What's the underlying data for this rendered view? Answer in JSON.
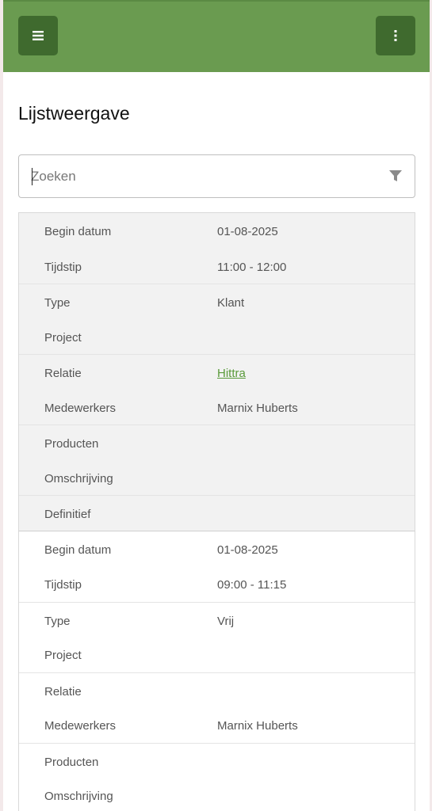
{
  "header": {
    "menu_icon": "hamburger-icon",
    "more_icon": "vertical-dots-icon",
    "bar_color": "#6a9b50",
    "button_color": "#3f6a2e"
  },
  "page_title": "Lijstweergave",
  "search": {
    "placeholder": "Zoeken",
    "value": "",
    "filter_icon": "filter-icon"
  },
  "records": [
    {
      "rows": [
        {
          "label": "Begin datum",
          "value": "01-08-2025"
        },
        {
          "label": "Tijdstip",
          "value": "11:00 - 12:00"
        },
        {
          "label": "Type",
          "value": "Klant"
        },
        {
          "label": "Project",
          "value": ""
        },
        {
          "label": "Relatie",
          "value": "Hittra",
          "link": true
        },
        {
          "label": "Medewerkers",
          "value": "Marnix Huberts"
        },
        {
          "label": "Producten",
          "value": ""
        },
        {
          "label": "Omschrijving",
          "value": ""
        },
        {
          "label": "Definitief",
          "value": ""
        }
      ]
    },
    {
      "rows": [
        {
          "label": "Begin datum",
          "value": "01-08-2025"
        },
        {
          "label": "Tijdstip",
          "value": "09:00 - 11:15"
        },
        {
          "label": "Type",
          "value": "Vrij"
        },
        {
          "label": "Project",
          "value": ""
        },
        {
          "label": "Relatie",
          "value": ""
        },
        {
          "label": "Medewerkers",
          "value": "Marnix Huberts"
        },
        {
          "label": "Producten",
          "value": ""
        },
        {
          "label": "Omschrijving",
          "value": ""
        }
      ]
    }
  ]
}
